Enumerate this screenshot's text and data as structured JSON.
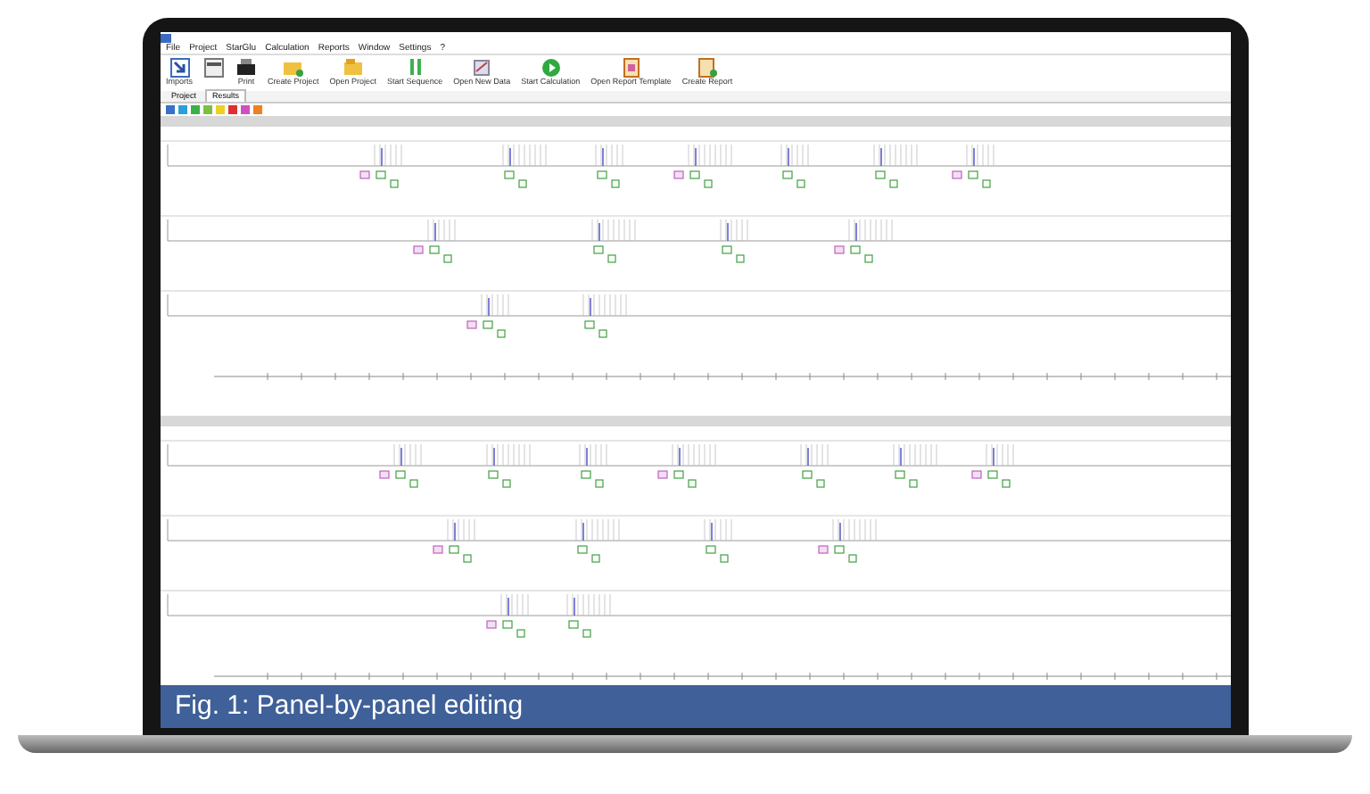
{
  "menu": [
    "File",
    "Project",
    "StarGlu",
    "Calculation",
    "Reports",
    "Window",
    "Settings",
    "?"
  ],
  "toolbar": [
    {
      "label": "Imports",
      "kind": "import"
    },
    {
      "kind": "sheet"
    },
    {
      "label": "Print",
      "kind": "print"
    },
    {
      "label": "Create Project",
      "kind": "folder-new"
    },
    {
      "label": "Open Project",
      "kind": "folder"
    },
    {
      "label": "Start Sequence",
      "kind": "arrows"
    },
    {
      "label": "Open New Data",
      "kind": "data"
    },
    {
      "label": "Start Calculation",
      "kind": "play"
    },
    {
      "label": "Open Report Template",
      "kind": "report"
    },
    {
      "label": "Create Report",
      "kind": "report-new"
    }
  ],
  "tabs": [
    {
      "label": "Project",
      "selected": false
    },
    {
      "label": "Results",
      "selected": true
    }
  ],
  "swatches": [
    {
      "color": "#3a70c8"
    },
    {
      "color": "#2aa0d8"
    },
    {
      "color": "#3cb04a"
    },
    {
      "color": "#7cc040"
    },
    {
      "color": "#f0d020"
    },
    {
      "color": "#e03030"
    },
    {
      "color": "#d050c0"
    },
    {
      "color": "#f08020"
    }
  ],
  "panels": [
    {
      "kind": "chromatogram"
    },
    {
      "kind": "chromatogram"
    }
  ],
  "caption": "Fig. 1: Panel-by-panel editing"
}
